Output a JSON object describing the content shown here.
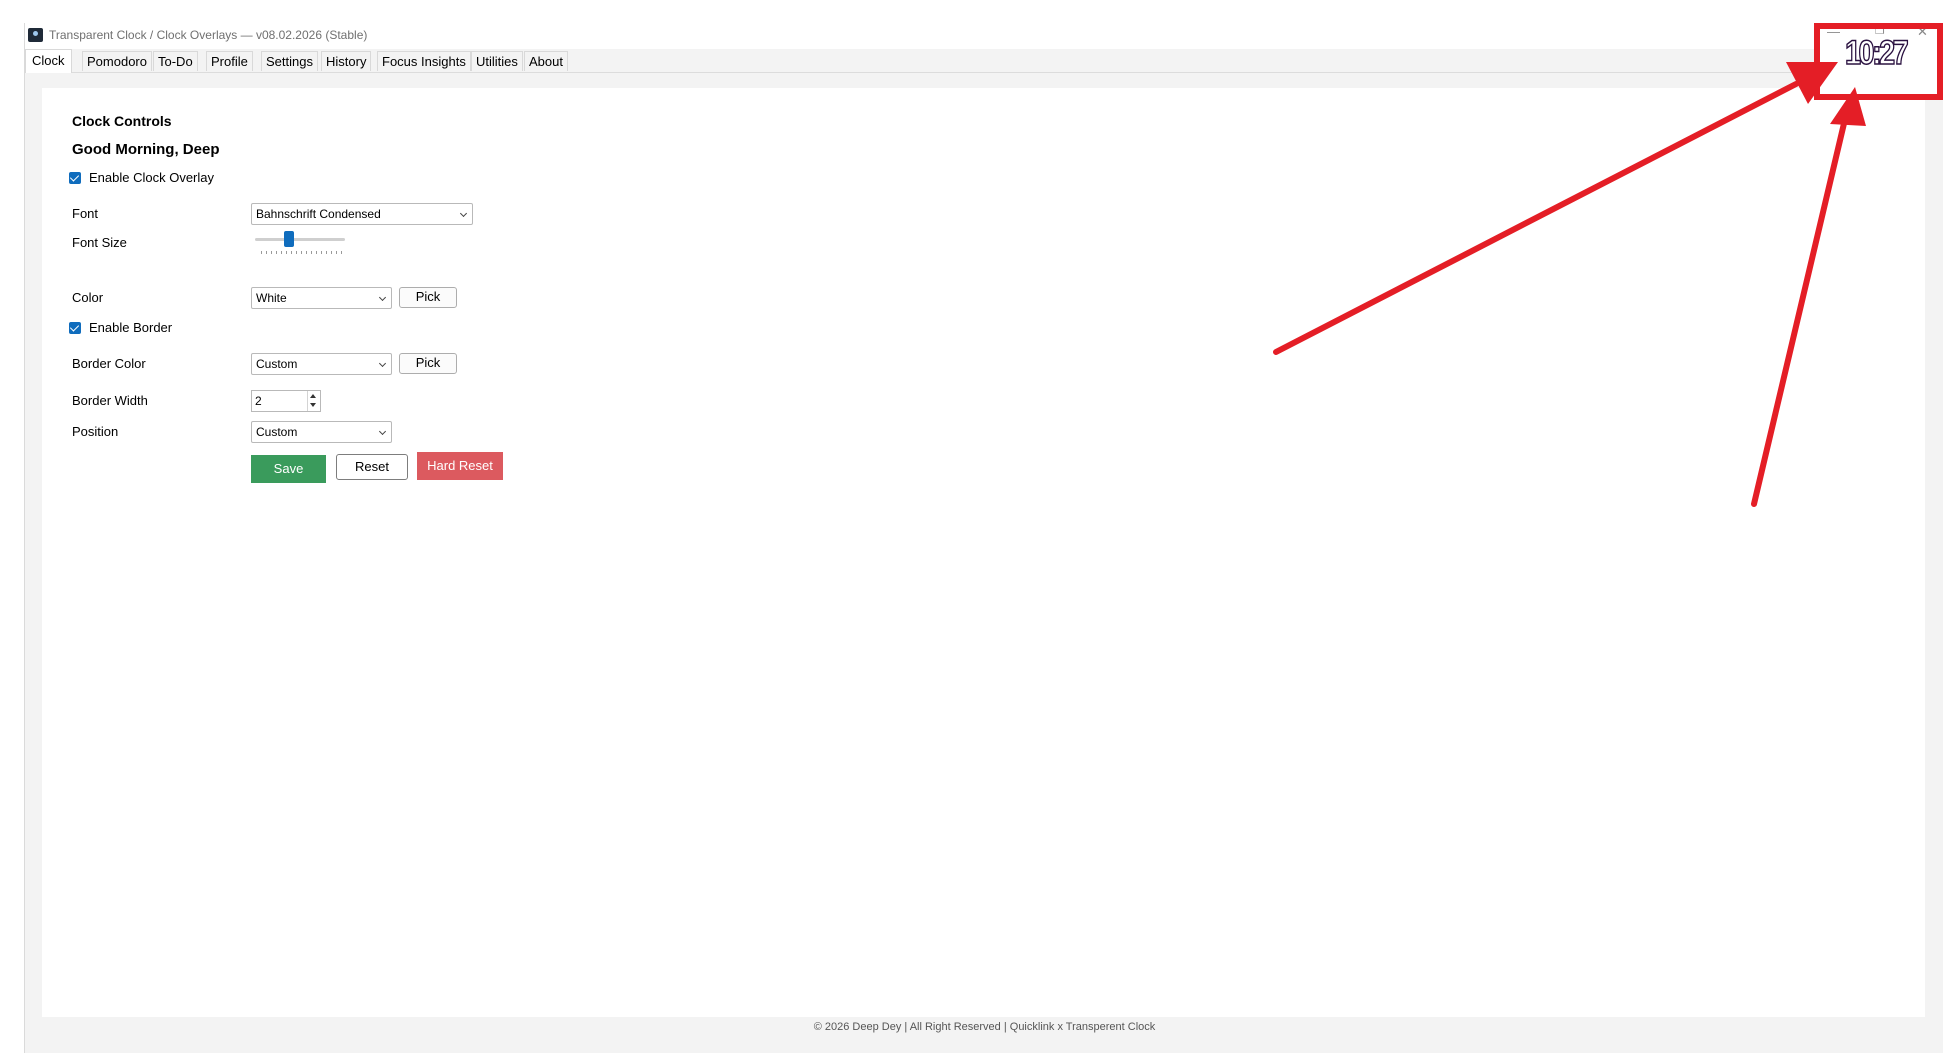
{
  "window": {
    "title": "Transparent Clock / Clock Overlays — v08.02.2026 (Stable)",
    "footer": "© 2026 Deep Dey | All Right Reserved | Quicklink x Transperent Clock"
  },
  "tabs": [
    {
      "label": "Clock",
      "active": true
    },
    {
      "label": "Pomodoro"
    },
    {
      "label": "To-Do"
    },
    {
      "label": "Profile"
    },
    {
      "label": "Settings"
    },
    {
      "label": "History"
    },
    {
      "label": "Focus Insights"
    },
    {
      "label": "Utilities"
    },
    {
      "label": "About"
    }
  ],
  "clock": {
    "heading": "Clock Controls",
    "greeting": "Good Morning, Deep",
    "enable_overlay_label": "Enable Clock Overlay",
    "enable_overlay_checked": true,
    "font_label": "Font",
    "font_value": "Bahnschrift Condensed",
    "font_size_label": "Font Size",
    "font_size_fraction": 0.38,
    "color_label": "Color",
    "color_value": "White",
    "pick_label": "Pick",
    "enable_border_label": "Enable Border",
    "enable_border_checked": true,
    "border_color_label": "Border Color",
    "border_color_value": "Custom",
    "border_width_label": "Border Width",
    "border_width_value": "2",
    "position_label": "Position",
    "position_value": "Custom",
    "save_label": "Save",
    "reset_label": "Reset",
    "hard_reset_label": "Hard Reset"
  },
  "overlay": {
    "time": "10:27",
    "window_controls": {
      "minimize": "—",
      "restore": "❐",
      "close": "✕"
    }
  },
  "colors": {
    "accent": "#0f6cbd",
    "save": "#3a9b5c",
    "hard_reset": "#dc5a5f",
    "annotation": "#e41e26"
  },
  "icons": [
    "app-icon",
    "chevron-down-icon",
    "checkbox-checked-icon",
    "spin-up-icon",
    "spin-down-icon",
    "minimize-icon",
    "restore-icon",
    "close-icon",
    "arrow-icon"
  ]
}
